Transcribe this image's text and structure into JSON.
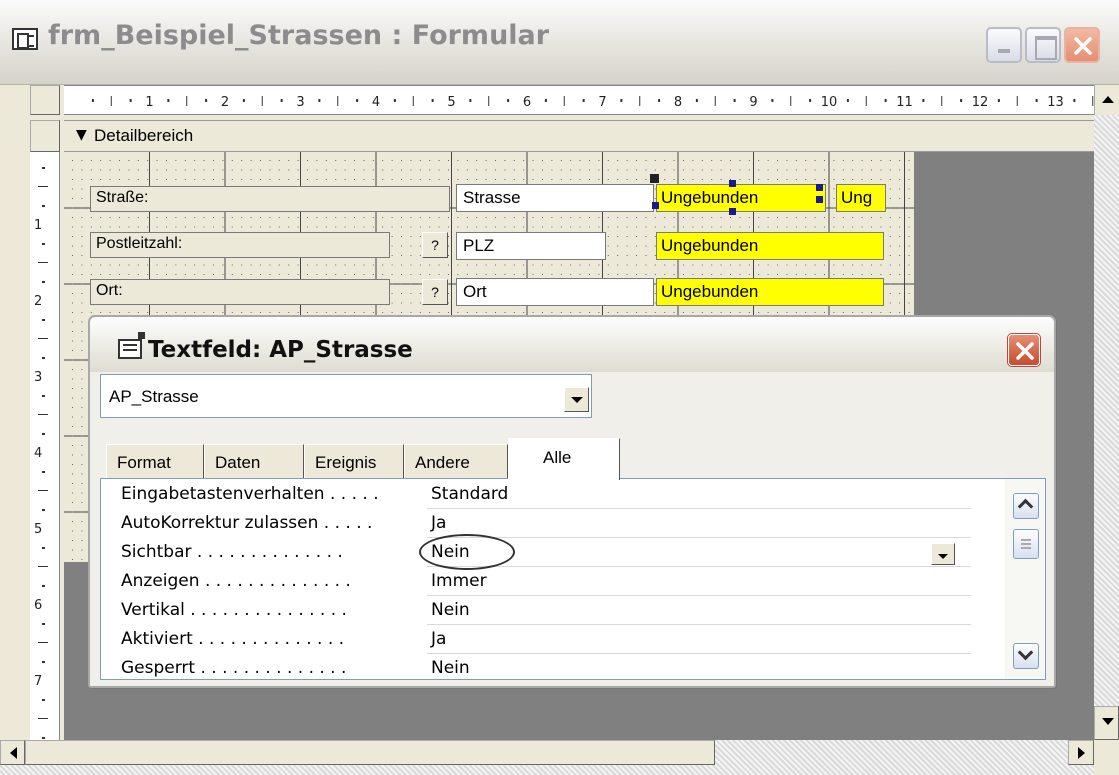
{
  "window": {
    "title": "frm_Beispiel_Strassen : Formular"
  },
  "ruler": {
    "h_labels": [
      "1",
      "2",
      "3",
      "4",
      "5",
      "6",
      "7",
      "8",
      "9",
      "10",
      "11",
      "12",
      "13"
    ],
    "v_labels": [
      "1",
      "2",
      "3",
      "4",
      "5",
      "6",
      "7"
    ]
  },
  "section": {
    "label": "Detailbereich"
  },
  "form": {
    "label_strasse": "Straße:",
    "label_plz": "Postleitzahl:",
    "label_ort": "Ort:",
    "btn_q1": "?",
    "btn_q2": "?",
    "field_strasse": "Strasse",
    "field_plz": "PLZ",
    "field_ort": "Ort",
    "unbound_1": "Ungebunden",
    "unbound_1b": "Ung",
    "unbound_2": "Ungebunden",
    "unbound_3": "Ungebunden"
  },
  "props": {
    "title": "Textfeld: AP_Strasse",
    "object": "AP_Strasse",
    "tabs": [
      "Format",
      "Daten",
      "Ereignis",
      "Andere",
      "Alle"
    ],
    "active_tab": "Alle",
    "rows": [
      {
        "name": "Eingabetastenverhalten . . . . .",
        "value": "Standard"
      },
      {
        "name": "AutoKorrektur zulassen . . . . .",
        "value": "Ja"
      },
      {
        "name": "Sichtbar . . . . . . . . . . . . . .",
        "value": "Nein"
      },
      {
        "name": "Anzeigen . . . . . . . . . . . . . .",
        "value": "Immer"
      },
      {
        "name": "Vertikal . . . . . . . . . . . . . . .",
        "value": "Nein"
      },
      {
        "name": "Aktiviert . . . . . . . . . . . . . .",
        "value": "Ja"
      },
      {
        "name": "Gesperrt . . . . . . . . . . . . . .",
        "value": "Nein"
      }
    ]
  },
  "colors": {
    "unbound_bg": "#ffff00",
    "canvas_bg": "#808080",
    "close_red": "#e5573a"
  }
}
